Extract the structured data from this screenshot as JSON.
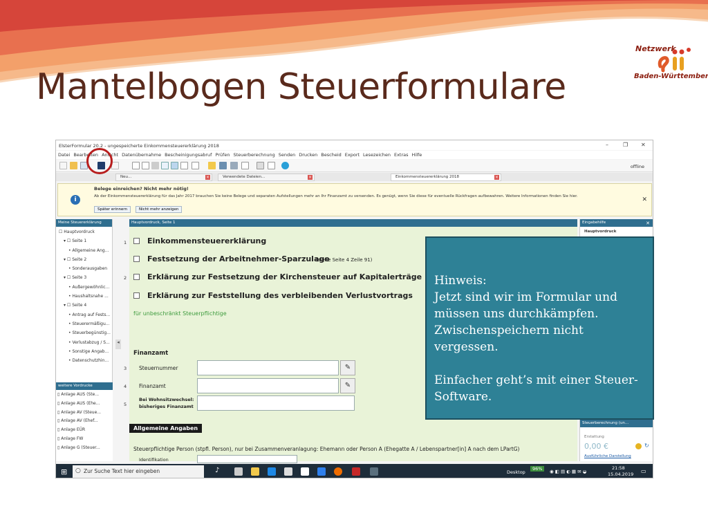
{
  "slide": {
    "title": "Mantelbogen Steuerformulare",
    "logo": {
      "line1": "Netzwerk",
      "line2": "Baden-Württemberg"
    }
  },
  "app": {
    "window_title": "ElsterFormular 20.2 - ungespeicherte Einkommensteuererklärung 2018",
    "menu": [
      "Datei",
      "Bearbeiten",
      "Ansicht",
      "Datenübernahme",
      "Bescheinigungsabruf",
      "Prüfen",
      "Steuerberechnung",
      "Senden",
      "Drucken",
      "Bescheid",
      "Export",
      "Lesezeichen",
      "Extras",
      "Hilfe"
    ],
    "toolbar_status": "offline",
    "tabs": [
      {
        "label": "Neu..."
      },
      {
        "label": "Verwendete Dateien..."
      },
      {
        "label": "Einkommensteuererklärung 2018"
      }
    ],
    "notice": {
      "heading": "Belege einreichen? Nicht mehr nötig!",
      "body": "Ab der Einkommensteuererklärung für das Jahr 2017 brauchen Sie keine Belege und separaten Aufstellungen mehr an Ihr Finanzamt zu versenden. Es genügt, wenn Sie diese für eventuelle Rückfragen aufbewahren. Weitere Informationen finden Sie hier.",
      "btn_later": "Später erinnern",
      "btn_never": "Nicht mehr anzeigen"
    },
    "left_panel": {
      "header": "Meine Steuererklärung",
      "items": [
        "Hauptvordruck",
        "Seite 1",
        "Allgemeine Ang...",
        "Seite 2",
        "Sonderausgaben",
        "Seite 3",
        "Außergewöhnlic...",
        "Haushaltsnahe ...",
        "Seite 4",
        "Antrag auf Fests...",
        "Steuerermäßigu...",
        "Steuerbegünstig...",
        "Verlustabzug / S...",
        "Sonstige Angab...",
        "Datenschutzhin..."
      ]
    },
    "left_panel2": {
      "header": "weitere Vordrucke",
      "items": [
        "Anlage AUS (Ste...",
        "Anlage AUS (Ehe...",
        "Anlage AV (Steue...",
        "Anlage AV (Ehef...",
        "Anlage EÜR",
        "Anlage FW",
        "Anlage G (Steuer..."
      ]
    },
    "form": {
      "header": "Hauptvordruck, Seite 1",
      "row1_num": "1",
      "row2_num": "2",
      "line1": "Einkommensteuererklärung",
      "line2": "Festsetzung der Arbeitnehmer-Sparzulage",
      "line2_note": "(siehe Seite 4 Zeile 91)",
      "line3": "Erklärung zur Festsetzung der Kirchensteuer auf Kapitalerträge",
      "line4": "Erklärung zur Feststellung des verbleibenden Verlustvortrags",
      "green": "für unbeschränkt Steuerpflichtige",
      "finanzamt_header": "Finanzamt",
      "r3": "3",
      "r3_label": "Steuernummer",
      "r4": "4",
      "r4_label": "Finanzamt",
      "r5": "5",
      "r5_label_a": "Bei Wohnsitzwechsel:",
      "r5_label_b": "bisheriges Finanzamt",
      "section": "Allgemeine Angaben",
      "person_line": "Steuerpflichtige Person (stpfl. Person), nur bei Zusammenveranlagung: Ehemann oder Person A (Ehegatte A / Lebenspartner[in] A nach dem LPartG)",
      "ident": "Identifikation"
    },
    "right_panel": {
      "header": "Eingabehilfe",
      "sub": "Hauptvordruck",
      "calc_header": "Steuerberechnung (un...",
      "calc_label": "Erstattung",
      "amount": "0,00 €",
      "link": "Ausführliche Darstellung"
    },
    "taskbar": {
      "search": "Zur Suche Text hier eingeben",
      "desktop": "Desktop",
      "battery": "96%",
      "time": "21:58",
      "date": "15.04.2019"
    }
  },
  "callout": {
    "l1": "Hinweis:",
    "l2": "Jetzt sind wir im Formular und",
    "l3": "müssen uns durchkämpfen.",
    "l4": "Zwischenspeichern nicht vergessen.",
    "l5": "Einfacher geht’s mit einer Steuer-",
    "l6": "Software."
  },
  "colors": {
    "title": "#5a2a1c",
    "callout_bg": "#2e8196",
    "panel_header": "#2f6e8f",
    "form_bg": "#e9f3d8",
    "highlight_circle": "#b81e1e"
  }
}
